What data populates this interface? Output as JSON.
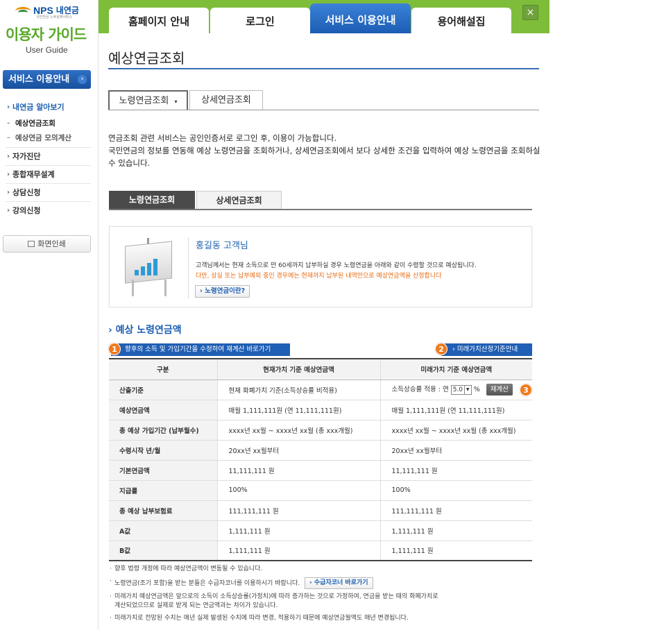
{
  "logo": {
    "brand": "NPS",
    "brand_kr": "내연금",
    "brand_small": "국민연금 노후설계서비스",
    "title": "이용자 가이드",
    "subtitle": "User Guide"
  },
  "sidebar": {
    "main_button": "서비스 이용안내",
    "items": [
      {
        "label": "내연금 알아보기"
      },
      {
        "label": "예상연금조회"
      },
      {
        "label": "예상연금 모의계산"
      },
      {
        "label": "자가진단"
      },
      {
        "label": "종합재무설계"
      },
      {
        "label": "상담신청"
      },
      {
        "label": "강의신청"
      }
    ],
    "print_label": "화면인쇄"
  },
  "topnav": {
    "tabs": [
      "홈페이지 안내",
      "로그인",
      "서비스 이용안내",
      "용어해설집"
    ],
    "active_index": 2,
    "close": "×"
  },
  "page": {
    "title": "예상연금조회",
    "subtabs": [
      "노령연금조회",
      "상세연금조회"
    ],
    "intro_1": "연금조회 관련 서비스는 공인인증서로 로그인 후, 이용이 가능합니다.",
    "intro_2": "국민연금의 정보를 연동해 예상 노령연금을 조회하거나, 상세연금조회에서 보다 상세한 조건을 입력하여 예상 노령연금을 조회하실 수 있습니다.",
    "inner_tabs": [
      "노령연금조회",
      "상세연금조회"
    ]
  },
  "customer": {
    "name": "홍길동 고객님",
    "line1": "고객님께서는 현재 소득으로 만 60세까지 납부하실 경우 노령연금을 아래와 같이 수령할 것으로 예상됩니다.",
    "line2": "다만, 상실 또는 납부예외 중인 경우에는 현재까지 납부된 내역만으로 예상연금액을 산정합니다",
    "button": "› 노령연금이란?"
  },
  "section": {
    "title": "› 예상 노령연금액",
    "btn_left": "향후의 소득 및 가입기간을 수정하여 재계산 바로가기",
    "btn_right": "› 미래가치산정기준안내",
    "badges": [
      "1",
      "2",
      "3"
    ]
  },
  "table": {
    "headers": [
      "구분",
      "현재가치 기준 예상연금액",
      "미래가치 기준 예상연금액"
    ],
    "rows": [
      {
        "label": "산출기준",
        "current": "현재 화폐가치 기준(소득상승률 비적용)",
        "future_prefix": "소득상승률 적용 : 연",
        "future_value": "5.0",
        "future_unit": "%",
        "recalc": "재계산"
      },
      {
        "label": "예상연금액",
        "current": "매월 1,111,111원 (연 11,111,111원)",
        "future": "매월 1,111,111원 (연 11,111,111원)"
      },
      {
        "label": "총 예상 가입기간 (납부월수)",
        "current": "xxxx년 xx월 ~ xxxx년 xx월 (총 xxx개월)",
        "future": "xxxx년 xx월 ~ xxxx년 xx월 (총 xxx개월)"
      },
      {
        "label": "수령시작 년/월",
        "current": "20xx년 xx월부터",
        "future": "20xx년 xx월부터"
      },
      {
        "label": "기본연금액",
        "current": "11,111,111 원",
        "future": "11,111,111 원"
      },
      {
        "label": "지급률",
        "current": "100%",
        "future": "100%"
      },
      {
        "label": "총 예상 납부보험료",
        "current": "111,111,111 원",
        "future": "111,111,111 원"
      },
      {
        "label": "A값",
        "current": "1,111,111 원",
        "future": "1,111,111 원"
      },
      {
        "label": "B값",
        "current": "1,111,111 원",
        "future": "1,111,111 원"
      }
    ]
  },
  "notes": {
    "n1": "향후 법령 개정에 따라 예상연금액이 변동될 수 있습니다.",
    "n2": "노령연금(조기 포함)을 받는 분들은 수급자코너를 이용하시기 바랍니다.",
    "n2_button": "› 수급자코너 바로가기",
    "n3a": "미래가치 예상연금액은 앞으로의 소득이 소득상승률(가정치)에 따라 증가하는 것으로 가정하여, 연금을 받는 때의 화폐가치로",
    "n3b": "계산되었으므로 실제로 받게 되는 연금액과는 차이가 있습니다.",
    "n4": "미래가치로 전망된 수치는 매년 실제 발생된 수치에 따라 변경, 적용하기 때문에 예상연금월액도 매년 변경됩니다."
  },
  "colors": {
    "green": "#7ebd3a",
    "blue": "#1f5fb5",
    "orange": "#f07a1c"
  }
}
